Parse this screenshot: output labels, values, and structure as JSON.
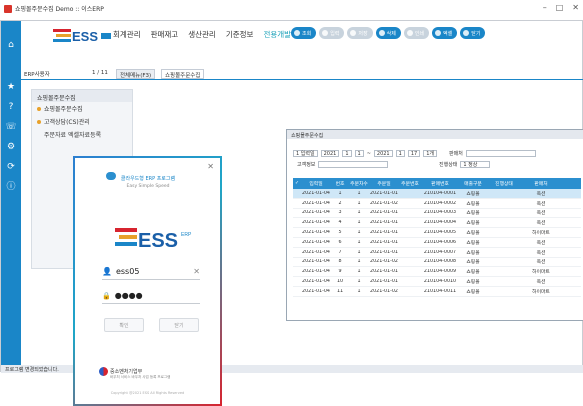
{
  "window": {
    "title": "쇼핑몰주문수집 Demo :: 이스ERP"
  },
  "menu": {
    "items": [
      {
        "label": "회계관리",
        "active": false
      },
      {
        "label": "판매재고",
        "active": false
      },
      {
        "label": "생산관리",
        "active": false
      },
      {
        "label": "기준정보",
        "active": false
      },
      {
        "label": "전용개발",
        "active": true
      }
    ]
  },
  "toolbar": [
    {
      "label": "조회",
      "disabled": false
    },
    {
      "label": "입력",
      "disabled": true
    },
    {
      "label": "저장",
      "disabled": true
    },
    {
      "label": "삭제",
      "disabled": false
    },
    {
      "label": "인쇄",
      "disabled": true
    },
    {
      "label": "엑셀",
      "disabled": false
    },
    {
      "label": "닫기",
      "disabled": false
    }
  ],
  "tabs": {
    "user": "ERP사용자",
    "page": "1 / 11",
    "items": [
      {
        "label": "전체메뉴(F3)",
        "selected": false
      },
      {
        "label": "쇼핑몰주문수집",
        "selected": true
      }
    ]
  },
  "panel": {
    "title": "쇼핑몰주문수집",
    "items": [
      {
        "label": "쇼핑몰주문수집",
        "bullet": true
      },
      {
        "label": "고객상담(CS)관리",
        "bullet": true
      },
      {
        "label": "주문자료 엑셀자료등록",
        "bullet": false
      }
    ]
  },
  "order_window": {
    "title": "쇼핑몰주문수집",
    "filters": {
      "date_type": "1 입력일",
      "y1": "2021",
      "m1": "1",
      "d1": "1",
      "y2": "2021",
      "m2": "1",
      "d2": "17",
      "period": "1개",
      "seller_label": "판매처",
      "customer_label": "고객정보",
      "status_label": "진행상태",
      "status_value": "1 정상"
    },
    "grid": {
      "headers": [
        "✓",
        "입력일",
        "번호",
        "주문차수",
        "주문일",
        "주문번호",
        "판매번호",
        "매출구분",
        "진행상태",
        "판매처"
      ],
      "rows": [
        [
          "",
          "2021-01-04",
          "1",
          "1",
          "2021-01-01",
          "",
          "210104-0001",
          "쇼핑몰",
          "",
          "옥션"
        ],
        [
          "",
          "2021-01-04",
          "2",
          "1",
          "2021-01-02",
          "",
          "210104-0002",
          "쇼핑몰",
          "",
          "옥션"
        ],
        [
          "",
          "2021-01-04",
          "3",
          "1",
          "2021-01-01",
          "",
          "210104-0003",
          "쇼핑몰",
          "",
          "옥션"
        ],
        [
          "",
          "2021-01-04",
          "4",
          "1",
          "2021-01-01",
          "",
          "210104-0004",
          "쇼핑몰",
          "",
          "옥션"
        ],
        [
          "",
          "2021-01-04",
          "5",
          "1",
          "2021-01-01",
          "",
          "210104-0005",
          "쇼핑몰",
          "",
          "하이마트"
        ],
        [
          "",
          "2021-01-04",
          "6",
          "1",
          "2021-01-01",
          "",
          "210104-0006",
          "쇼핑몰",
          "",
          "옥션"
        ],
        [
          "",
          "2021-01-04",
          "7",
          "1",
          "2021-01-01",
          "",
          "210104-0007",
          "쇼핑몰",
          "",
          "옥션"
        ],
        [
          "",
          "2021-01-04",
          "8",
          "1",
          "2021-01-02",
          "",
          "210104-0008",
          "쇼핑몰",
          "",
          "옥션"
        ],
        [
          "",
          "2021-01-04",
          "9",
          "1",
          "2021-01-01",
          "",
          "210104-0009",
          "쇼핑몰",
          "",
          "하이마트"
        ],
        [
          "",
          "2021-01-04",
          "10",
          "1",
          "2021-01-01",
          "",
          "210104-0010",
          "쇼핑몰",
          "",
          "옥션"
        ],
        [
          "",
          "2021-01-04",
          "11",
          "1",
          "2021-01-02",
          "",
          "210104-0011",
          "쇼핑몰",
          "",
          "하이마트"
        ]
      ]
    }
  },
  "status": "프로그램 변경되었습니다.",
  "login": {
    "brand_title": "클라우드형 ERP 프로그램",
    "brand_sub": "Easy Simple Speed",
    "logo": "ESS",
    "logo_tag": "ERP",
    "username": "ess05",
    "password_mask": "●●●●",
    "confirm": "확인",
    "cancel": "닫기",
    "ministry": "중소벤처기업부",
    "ministry_sub": "바우처 서비스 바우처 사업 등록 프로그램",
    "copyright": "Copyright @2021 ESS All Rights Reserved"
  },
  "colors": {
    "accent": "#1a86c8",
    "brand_red": "#d7242f",
    "grid_header": "#2b8fcf"
  }
}
